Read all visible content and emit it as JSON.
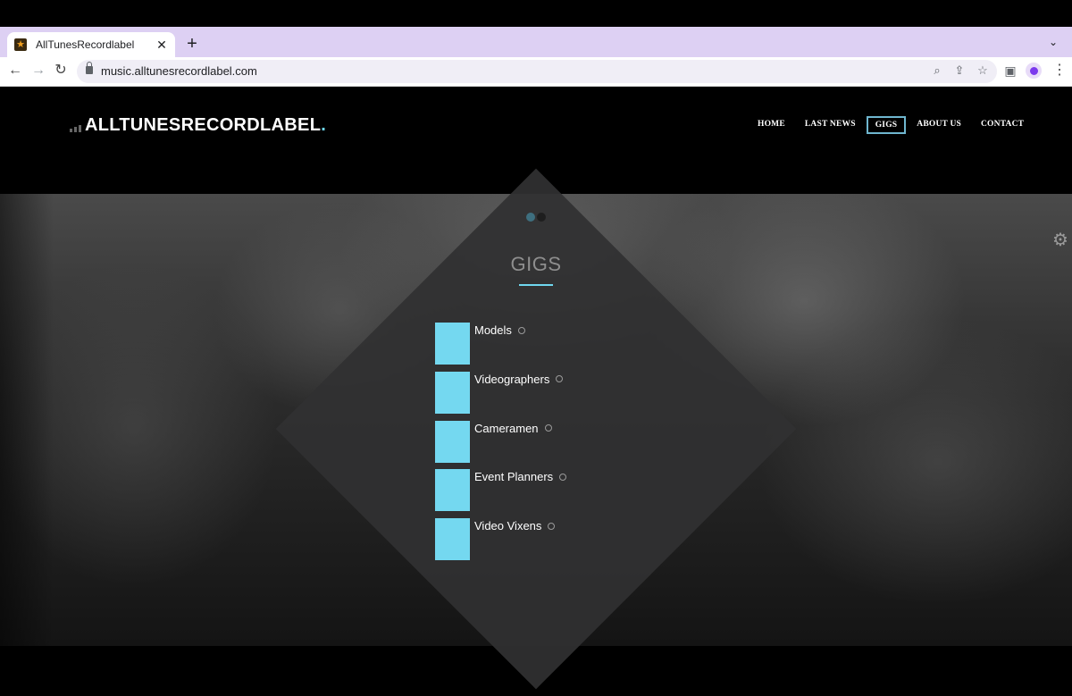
{
  "browser": {
    "tab_title": "AllTunesRecordlabel",
    "url": "music.alltunesrecordlabel.com",
    "favicon": "star-icon"
  },
  "site": {
    "logo_text": "ALLTUNESRECORDLABEL",
    "logo_dot": ".",
    "nav": [
      {
        "label": "HOME",
        "active": false
      },
      {
        "label": "LAST NEWS",
        "active": false
      },
      {
        "label": "GIGS",
        "active": true
      },
      {
        "label": "ABOUT US",
        "active": false
      },
      {
        "label": "CONTACT",
        "active": false
      }
    ],
    "section_title": "GIGS",
    "gigs": [
      {
        "label": "Models"
      },
      {
        "label": "Videographers"
      },
      {
        "label": "Cameramen"
      },
      {
        "label": "Event Planners"
      },
      {
        "label": "Video Vixens"
      }
    ],
    "colors": {
      "accent": "#6fd7ef",
      "thumb": "#74d8f0",
      "nav_active_border": "#6fb6cf"
    }
  }
}
